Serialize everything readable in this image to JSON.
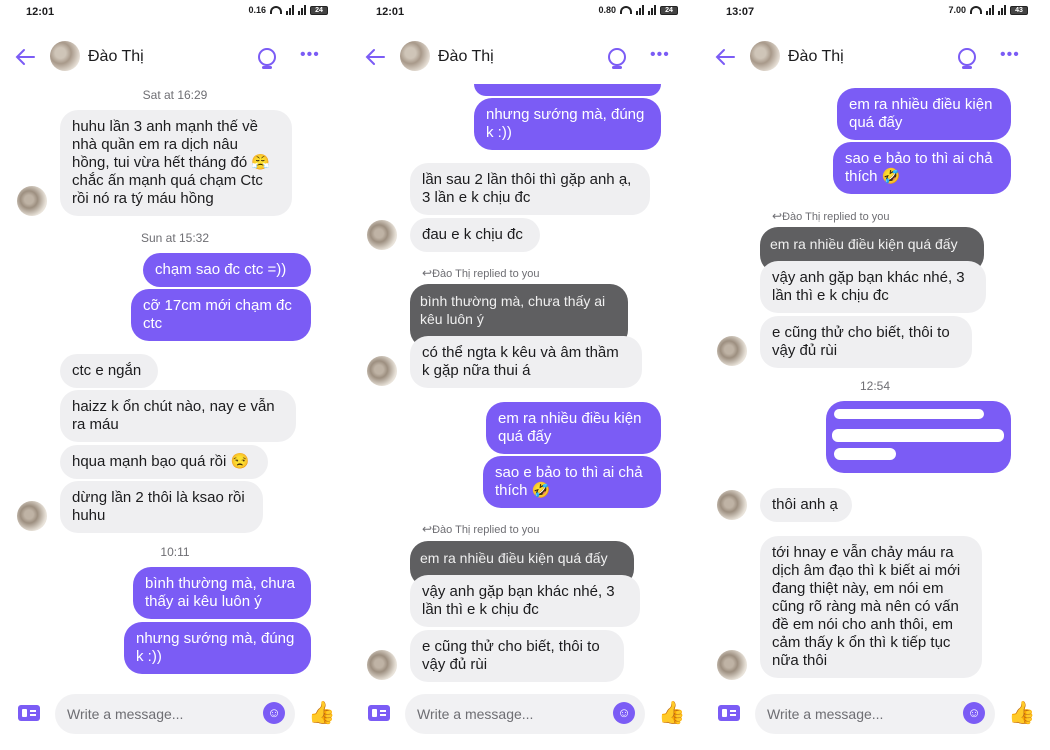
{
  "colors": {
    "accent": "#7b5cf5",
    "incoming": "#efeff1",
    "quoted": "#5f5f61"
  },
  "contact_name": "Đào Thị",
  "composer": {
    "placeholder": "Write a message..."
  },
  "screens": [
    {
      "status": {
        "time": "12:01",
        "speed": "0.16",
        "battery": "24"
      },
      "stamps": [
        "Sat at 16:29",
        "Sun at 15:32",
        "10:11"
      ],
      "messages": [
        "huhu lần 3 anh mạnh thế về\nnhà quần em ra dịch nâu\nhồng, tui vừa hết tháng đó 😤\nchắc ấn mạnh quá chạm Ctc\nrồi nó ra tý máu hồng",
        "chạm sao đc ctc =))",
        "cỡ 17cm mới chạm đc\nctc",
        "ctc e ngắn",
        "haizz k ổn chút nào, nay e vẫn\nra máu",
        "hqua mạnh bạo quá rồi 😒",
        "dừng lần 2 thôi là ksao rồi\nhuhu",
        "bình thường mà, chưa\nthấy ai kêu luôn ý",
        "nhưng sướng mà, đúng\nk :))"
      ]
    },
    {
      "status": {
        "time": "12:01",
        "speed": "0.80",
        "battery": "24"
      },
      "replied_label": "Đào Thị replied to you",
      "messages": [
        "nhưng sướng mà, đúng\nk :))",
        "lần sau 2 lần thôi thì gặp anh ạ,\n3 lần e k chịu đc",
        "đau e k chịu đc",
        "bình thường mà, chưa thấy ai\nkêu luôn ý",
        "có thể ngta k kêu và âm thầm\nk gặp nữa thui á",
        "em ra nhiều điều kiện\nquá đấy",
        "sao e bảo to thì ai chả\nthích 🤣",
        "em ra nhiều điều kiện quá đấy",
        "vậy anh gặp bạn khác nhé, 3\nlần thì e k chịu đc",
        "e cũng thử cho biết, thôi to\nvậy đủ rùi"
      ]
    },
    {
      "status": {
        "time": "13:07",
        "speed": "7.00",
        "battery": "43"
      },
      "replied_label": "Đào Thị replied to you",
      "stamps": [
        "12:54"
      ],
      "messages": [
        "em ra nhiều điều kiện\nquá đấy",
        "sao e bảo to thì ai chả\nthích 🤣",
        "em ra nhiều điều kiện quá đấy",
        "vậy anh gặp bạn khác nhé, 3\nlần thì e k chịu đc",
        "e cũng thử cho biết, thôi to\nvậy đủ rùi",
        "thôi anh ạ",
        "tới hnay e vẫn chảy máu ra\ndịch âm đạo thì k biết ai mới\nđang thiệt này, em nói em\ncũng rõ ràng mà nên có vấn\nđề em nói cho anh thôi, em\ncảm thấy k ổn thì k tiếp tục\nnữa thôi"
      ]
    }
  ]
}
